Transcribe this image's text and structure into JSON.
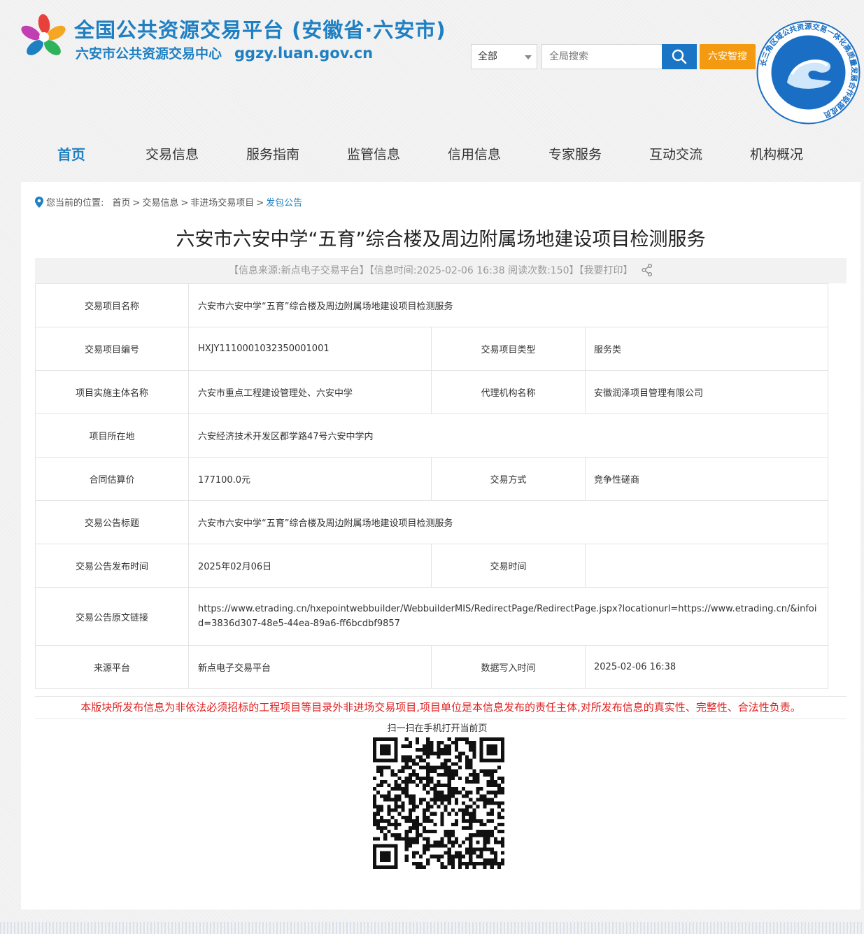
{
  "header": {
    "title": "全国公共资源交易平台 (安徽省·六安市)",
    "subtitle": "六安市公共资源交易中心",
    "domain": "ggzy.luan.gov.cn",
    "scope_select": "全部",
    "search_placeholder": "全局搜索",
    "smart_search_label": "六安智搜",
    "brand_color": "#1e7fc2",
    "accent_color": "#f39a11",
    "seal_text": "长三角区域公共资源交易一体化高质量发展合作联盟成员"
  },
  "nav": {
    "items": [
      {
        "label": "首页",
        "active": true
      },
      {
        "label": "交易信息"
      },
      {
        "label": "服务指南"
      },
      {
        "label": "监管信息"
      },
      {
        "label": "信用信息"
      },
      {
        "label": "专家服务"
      },
      {
        "label": "互动交流"
      },
      {
        "label": "机构概况"
      }
    ]
  },
  "breadcrumb": {
    "prefix": "您当前的位置:",
    "items": [
      "首页",
      "交易信息",
      "非进场交易项目"
    ],
    "current": "发包公告"
  },
  "article": {
    "title": "六安市六安中学“五育”综合楼及周边附属场地建设项目检测服务",
    "meta": "【信息来源:新点电子交易平台】【信息时间:2025-02-06 16:38   阅读次数:150】【我要打印】"
  },
  "info_table": {
    "project_name_label": "交易项目名称",
    "project_name": "六安市六安中学“五育”综合楼及周边附属场地建设项目检测服务",
    "project_code_label": "交易项目编号",
    "project_code": "HXJY1110001032350001001",
    "project_type_label": "交易项目类型",
    "project_type": "服务类",
    "owner_label": "项目实施主体名称",
    "owner": "六安市重点工程建设管理处、六安中学",
    "agency_label": "代理机构名称",
    "agency": "安徽润泽项目管理有限公司",
    "location_label": "项目所在地",
    "location": "六安经济技术开发区郡学路47号六安中学内",
    "price_label": "合同估算价",
    "price": "177100.0元",
    "method_label": "交易方式",
    "method": "竞争性磋商",
    "notice_title_label": "交易公告标题",
    "notice_title": "六安市六安中学“五育”综合楼及周边附属场地建设项目检测服务",
    "publish_time_label": "交易公告发布时间",
    "publish_time": "2025年02月06日",
    "trade_time_label": "交易时间",
    "trade_time": "",
    "source_link_label": "交易公告原文链接",
    "source_link": "https://www.etrading.cn/hxepointwebbuilder/WebbuilderMIS/RedirectPage/RedirectPage.jspx?locationurl=https://www.etrading.cn/&infoid=3836d307-48e5-44ea-89a6-ff6bcdbf9857",
    "platform_label": "来源平台",
    "platform": "新点电子交易平台",
    "write_time_label": "数据写入时间",
    "write_time": "2025-02-06 16:38"
  },
  "disclaimer": "本版块所发布信息为非依法必须招标的工程项目等目录外非进场交易项目,项目单位是本信息发布的责任主体,对所发布信息的真实性、完整性、合法性负责。",
  "qr": {
    "caption": "扫一扫在手机打开当前页"
  }
}
